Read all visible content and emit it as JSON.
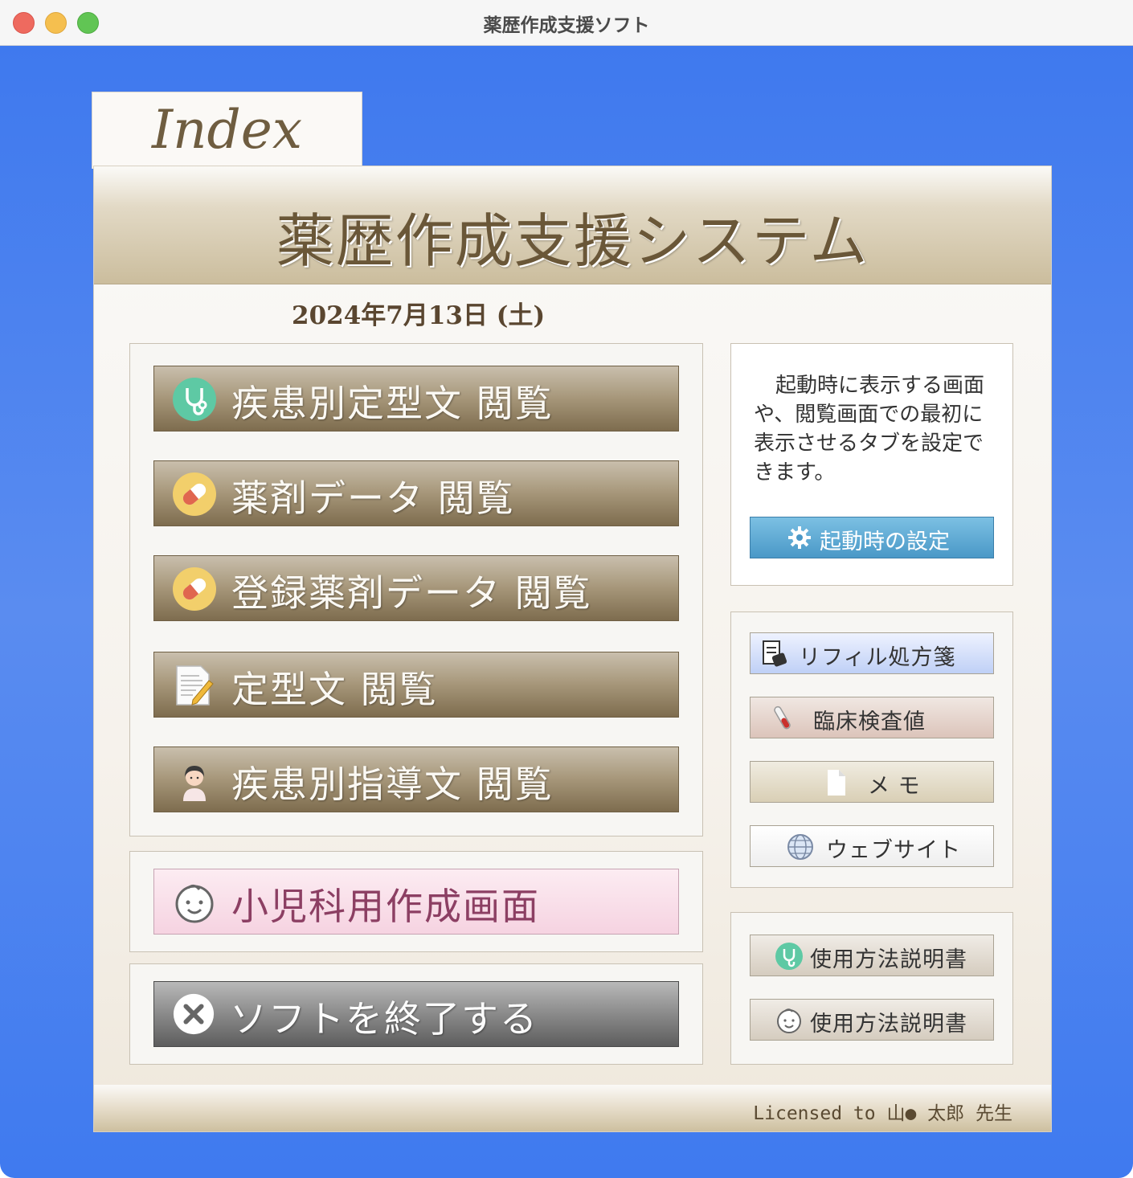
{
  "window": {
    "title": "薬歴作成支援ソフト"
  },
  "tab": {
    "label": "Index"
  },
  "banner": {
    "title": "薬歴作成支援システム"
  },
  "date": "2024年7月13日 (土)",
  "main_buttons": [
    {
      "label": "疾患別定型文  閲覧",
      "icon": "stethoscope-icon"
    },
    {
      "label": "薬剤データ  閲覧",
      "icon": "capsule-icon"
    },
    {
      "label": "登録薬剤データ  閲覧",
      "icon": "capsule-icon"
    },
    {
      "label": "定型文  閲覧",
      "icon": "notepad-icon"
    },
    {
      "label": "疾患別指導文  閲覧",
      "icon": "nurse-icon"
    }
  ],
  "pediatric_button": {
    "label": "小児科用作成画面",
    "icon": "baby-face-icon"
  },
  "exit_button": {
    "label": "ソフトを終了する",
    "icon": "close-circle-icon"
  },
  "startup_panel": {
    "description": "起動時に表示する画面や、閲覧画面での最初に表示させるタブを設定できます。",
    "settings_label": "起動時の設定"
  },
  "tools": [
    {
      "label": "リフィル処方箋",
      "icon": "prescription-icon"
    },
    {
      "label": "臨床検査値",
      "icon": "test-tube-icon"
    },
    {
      "label": "メ  モ",
      "icon": "document-icon"
    },
    {
      "label": "ウェブサイト",
      "icon": "globe-icon"
    }
  ],
  "manuals": [
    {
      "label": "使用方法説明書",
      "icon": "stethoscope-icon"
    },
    {
      "label": "使用方法説明書",
      "icon": "baby-face-icon"
    }
  ],
  "footer": {
    "license": "Licensed to 山●  太郎  先生"
  }
}
